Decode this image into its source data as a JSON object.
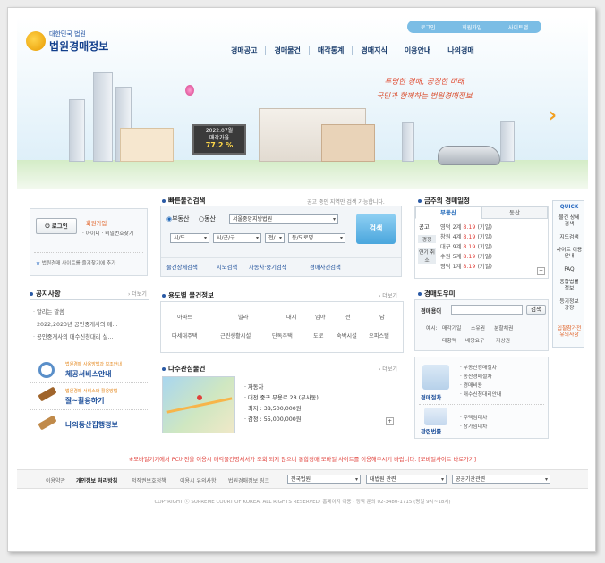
{
  "header": {
    "logo_small": "대한민국 법원",
    "logo_title": "법원경매정보",
    "top_links": [
      "로그인",
      "회원가입",
      "사이트맵"
    ],
    "nav": [
      "경매공고",
      "경매물건",
      "매각통계",
      "경매지식",
      "이용안내",
      "나의경매"
    ],
    "slogan_line1": "투명한 경매, 공정한 미래",
    "slogan_line2": "국민과 함께하는 법원경매정보",
    "billboard_line1": "2022.07월",
    "billboard_line2": "매각가율",
    "billboard_value": "77.2 %"
  },
  "login": {
    "button": "로그인",
    "join": "· 회원가입",
    "find": "· 아이디 · 비밀번호찾기",
    "add_favorite": "법원경매 사이트를 즐겨찾기에 추가"
  },
  "quick_search": {
    "title": "빠른물건검색",
    "note": "공고 중인 지역만 검색 가능합니다.",
    "radio_realestate": "부동산",
    "radio_movable": "동산",
    "court": "서울중앙지방법원",
    "sido": "시/도",
    "sigungu": "시/군/구",
    "dong_prefix": "전/",
    "dong": "동/도로명",
    "search_button": "검색",
    "links": [
      "물건상세검색",
      "지도검색",
      "자동차·중기검색",
      "경매사건검색"
    ]
  },
  "schedule": {
    "title": "금주의 경매일정",
    "tab1": "부동산",
    "tab2": "동산",
    "side_labels": [
      "공고",
      "경정",
      "연기 취소"
    ],
    "items": [
      {
        "court": "영덕 2계",
        "date": "8.19",
        "day": "(기일)"
      },
      {
        "court": "창원 4계",
        "date": "8.19",
        "day": "(기일)"
      },
      {
        "court": "대구 9계",
        "date": "8.19",
        "day": "(기일)"
      },
      {
        "court": "수원 5계",
        "date": "8.19",
        "day": "(기일)"
      },
      {
        "court": "영덕 1계",
        "date": "8.19",
        "day": "(기일)"
      }
    ]
  },
  "notice": {
    "title": "공지사항",
    "more": "› 더보기",
    "items": [
      "알리는 말씀",
      "2022,2023년 공인중개사의 매...",
      "공인중개사의 매수신청대리 실..."
    ]
  },
  "service_banners": {
    "b1_small": "법원경매 사용방법과 보조안내",
    "b1": "체공서비스안내",
    "b2_small": "법원경매 서비스와 활용방법",
    "b2": "잘~활용하기",
    "b3": "나의동산집행정보"
  },
  "usage": {
    "title": "용도별 물건정보",
    "more": "› 더보기",
    "row1": [
      "아파트",
      "빌라",
      "대지",
      "임야",
      "전",
      "답"
    ],
    "row2": [
      "다세대주택",
      "근린생활시설",
      "단독주택",
      "도로",
      "숙박시설",
      "오피스텔"
    ]
  },
  "popular": {
    "title": "다수관심물건",
    "more": "› 더보기",
    "lines": [
      "· 자동차",
      "· 대전 중구 부용로 28 (부사동)",
      "· 최저 : 38,500,000원",
      "· 감정 : 55,000,000원"
    ]
  },
  "dictionary": {
    "title": "경매도우미",
    "label": "경매용어",
    "search_button": "검색",
    "terms_row1": [
      "예시:",
      "매각기일",
      "소유권",
      "분할채권"
    ],
    "terms_row2": [
      "대항력",
      "배당요구",
      "지상권"
    ]
  },
  "procedure": {
    "label1": "경매절차",
    "label2": "관련법률",
    "links1": [
      "· 부동산경매절차",
      "· 동산경매절차",
      "· 경매비용",
      "· 매수신청대리안내"
    ],
    "links2": [
      "· 주택임대차",
      "· 상가임대차"
    ]
  },
  "quick_menu": {
    "title": "QUICK",
    "items": [
      "물건 상세검색",
      "지도검색",
      "사이트 이용안내",
      "FAQ",
      "종합법률 정보",
      "등기정보 광장"
    ],
    "bottom": "입찰참가전 유의사항"
  },
  "mobile_notice": "※모바일기기에서 PC버전을 이용시 매각물건명세서가 조회 되지 않으니 통합경매 모바일 사이트를 이용해주시기 바랍니다. [모바일사이트 바로가기]",
  "footer": {
    "links": [
      "이용약관",
      "개인정보 처리방침",
      "저작권보호정책",
      "이용시 유의사항",
      "법원경매정보 링크"
    ],
    "selects": [
      "전국법원",
      "대법원 관련",
      "공공기관관련"
    ],
    "copyright": "COPYRIGHT ⓒ SUPREME COURT OF KOREA. ALL RIGHTS RESERVED. 홈페이지 이용 · 정책 문의 02-3480-1715 (평일 9시~18시)"
  }
}
